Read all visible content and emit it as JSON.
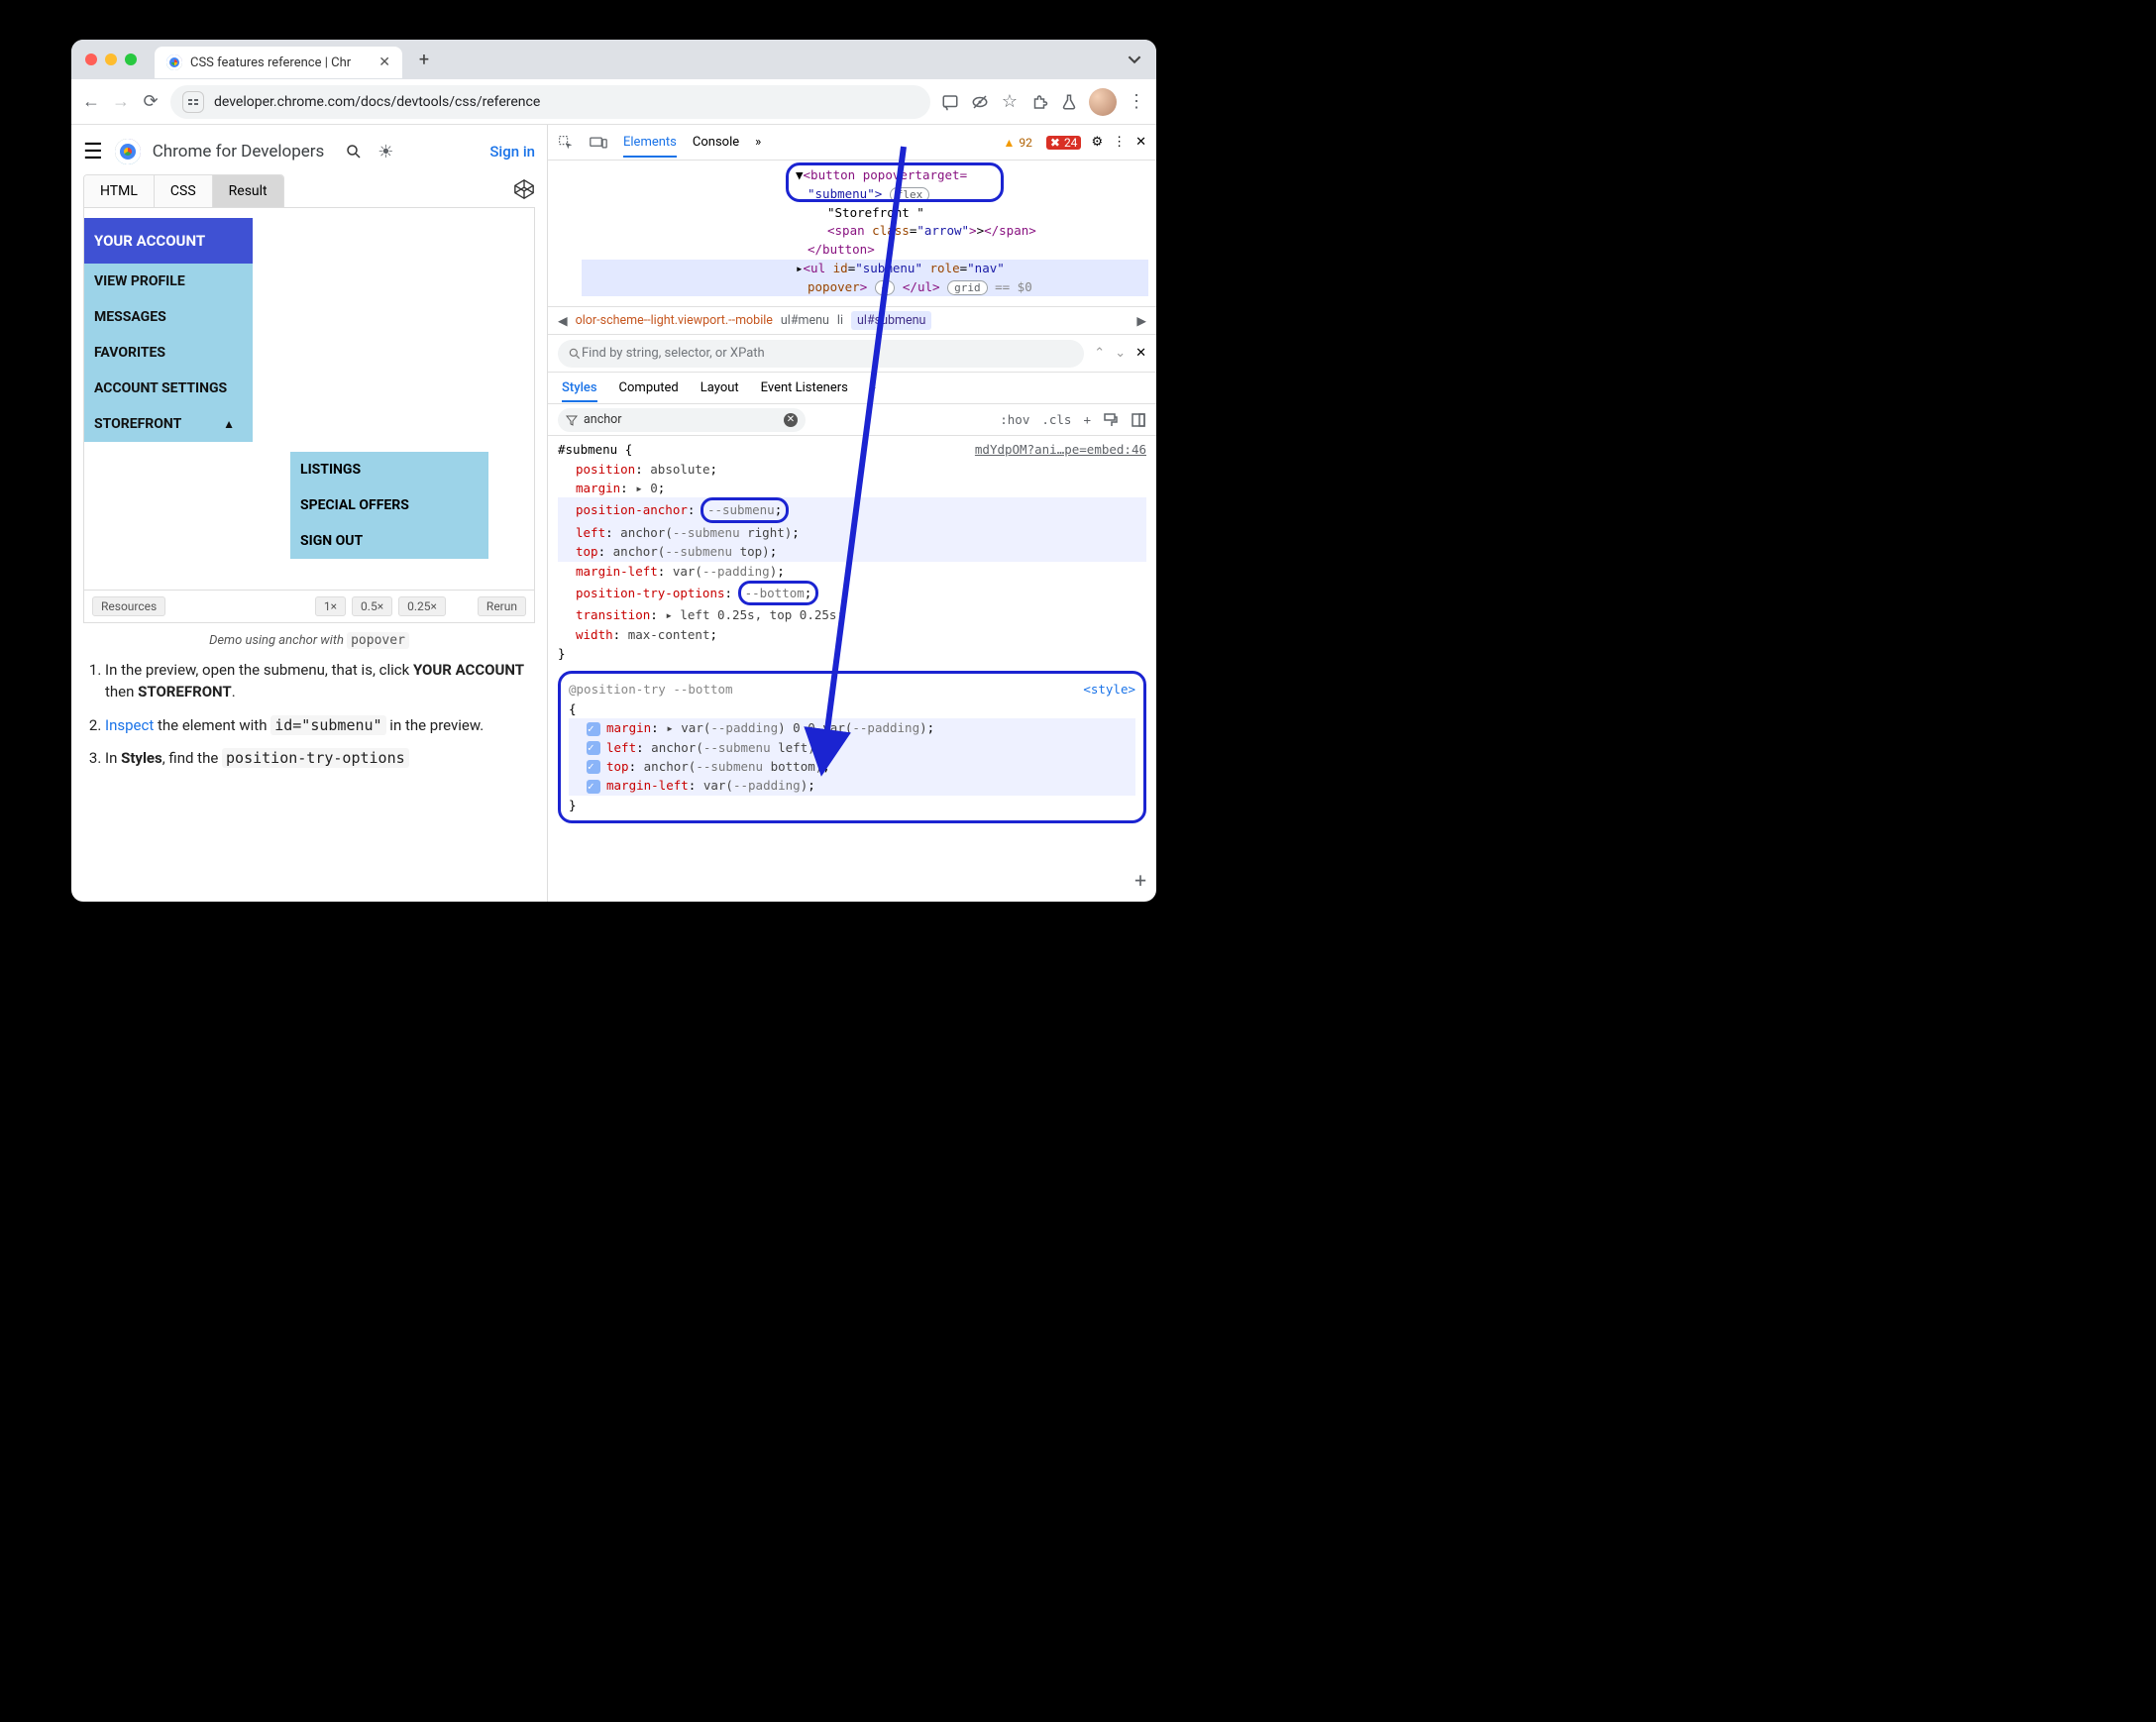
{
  "browser": {
    "tab_title": "CSS features reference | Chr",
    "url": "developer.chrome.com/docs/devtools/css/reference"
  },
  "page": {
    "brand": "Chrome for Developers",
    "signin": "Sign in",
    "code_tabs": {
      "html": "HTML",
      "css": "CSS",
      "result": "Result"
    },
    "menu": {
      "header": "YOUR ACCOUNT",
      "items": [
        "VIEW PROFILE",
        "MESSAGES",
        "FAVORITES",
        "ACCOUNT SETTINGS",
        "STOREFRONT"
      ]
    },
    "submenu": [
      "LISTINGS",
      "SPECIAL OFFERS",
      "SIGN OUT"
    ],
    "preview_footer": {
      "resources": "Resources",
      "z1": "1×",
      "z05": "0.5×",
      "z025": "0.25×",
      "rerun": "Rerun"
    },
    "caption_pre": "Demo using anchor with ",
    "caption_code": "popover",
    "instructions": {
      "i1a": "In the preview, open the submenu, that is, click ",
      "i1b": "YOUR ACCOUNT",
      "i1c": " then ",
      "i1d": "STOREFRONT",
      "i2a": "Inspect",
      "i2b": " the element with ",
      "i2c": "id=\"submenu\"",
      "i2d": " in the preview.",
      "i3a": "In ",
      "i3b": "Styles",
      "i3c": ", find the ",
      "i3d": "position-try-options"
    }
  },
  "devtools": {
    "tabs": {
      "elements": "Elements",
      "console": "Console"
    },
    "warn_count": "92",
    "err_count": "24",
    "elements": {
      "line1a": "<button popovertarget=",
      "line1b": "\"submenu\">",
      "flex_pill": "flex",
      "line_txt": "\"Storefront \"",
      "span_open": "<span class=\"arrow\">",
      "span_txt": ">",
      "span_close": "</span>",
      "btn_close": "</button>",
      "ul": "<ul id=\"submenu\" role=\"nav\" popover>",
      "grid_pill": "grid",
      "ul_close": "</ul>",
      "eq0": " == $0"
    },
    "crumbs": {
      "c1": "olor-scheme--light.viewport.--mobile",
      "c2": "ul#menu",
      "c3": "li",
      "c4": "ul#submenu"
    },
    "search_placeholder": "Find by string, selector, or XPath",
    "pane_tabs": {
      "styles": "Styles",
      "computed": "Computed",
      "layout": "Layout",
      "listeners": "Event Listeners"
    },
    "filter_text": "anchor",
    "toggles": {
      "hov": ":hov",
      "cls": ".cls"
    },
    "styles": {
      "selector": "#submenu {",
      "source": "mdYdpOM?ani…pe=embed:46",
      "p1": "position",
      "v1": "absolute",
      "p2": "margin",
      "v2": "▸ 0",
      "p3": "position-anchor",
      "v3": "--submenu",
      "p4": "left",
      "v4a": "anchor(",
      "v4b": "--submenu",
      "v4c": " right)",
      "p5": "top",
      "v5a": "anchor(",
      "v5b": "--submenu",
      "v5c": " top)",
      "p6": "margin-left",
      "v6a": "var(",
      "v6b": "--padding",
      "v6c": ")",
      "p7": "position-try-options",
      "v7": "--bottom",
      "p8": "transition",
      "v8": "▸ left 0.25s, top 0.25s",
      "p9": "width",
      "v9": "max-content",
      "close": "}"
    },
    "position_try": {
      "header": "@position-try --bottom",
      "open": "{",
      "style_src": "<style>",
      "p1": "margin",
      "v1a": "▸ var(",
      "v1b": "--padding",
      "v1c": ") 0 0 var(",
      "v1d": "--padding",
      "v1e": ")",
      "p2": "left",
      "v2a": "anchor(",
      "v2b": "--submenu",
      "v2c": " left)",
      "p3": "top",
      "v3a": "anchor(",
      "v3b": "--submenu",
      "v3c": " bottom)",
      "p4": "margin-left",
      "v4a": "var(",
      "v4b": "--padding",
      "v4c": ")",
      "close": "}"
    }
  }
}
